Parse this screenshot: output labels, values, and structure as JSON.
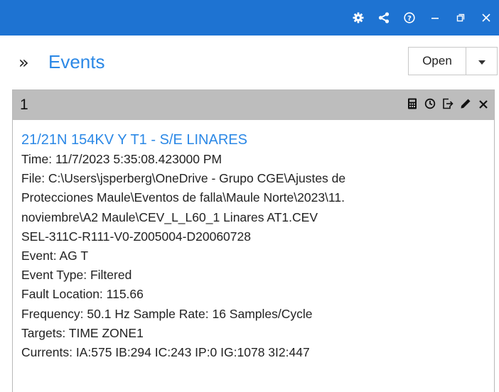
{
  "titlebar": {
    "icons": [
      "gear-icon",
      "share-icon",
      "help-icon",
      "minimize-icon",
      "restore-icon",
      "close-icon"
    ]
  },
  "header": {
    "expander_glyph": "»",
    "title": "Events",
    "open_button_label": "Open"
  },
  "panel": {
    "number": "1",
    "tools": [
      "calculator-icon",
      "clock-icon",
      "export-icon",
      "edit-icon",
      "close-icon"
    ]
  },
  "event": {
    "title": "21/21N 154KV Y T1 - S/E LINARES",
    "lines": [
      "Time:  11/7/2023 5:35:08.423000 PM",
      "File: C:\\Users\\jsperberg\\OneDrive - Grupo CGE\\Ajustes de",
      "Protecciones Maule\\Eventos de falla\\Maule Norte\\2023\\11.",
      "noviembre\\A2 Maule\\CEV_L_L60_1 Linares AT1.CEV",
      "SEL-311C-R111-V0-Z005004-D20060728",
      "Event: AG T",
      "Event Type: Filtered",
      "Fault Location: 115.66",
      "Frequency: 50.1 Hz   Sample Rate: 16 Samples/Cycle",
      "Targets: TIME ZONE1",
      "Currents: IA:575 IB:294 IC:243 IP:0 IG:1078 3I2:447"
    ]
  },
  "colors": {
    "titlebar_bg": "#1e73d2",
    "accent": "#2b88e6",
    "panel_header_bg": "#bdbdbd"
  }
}
